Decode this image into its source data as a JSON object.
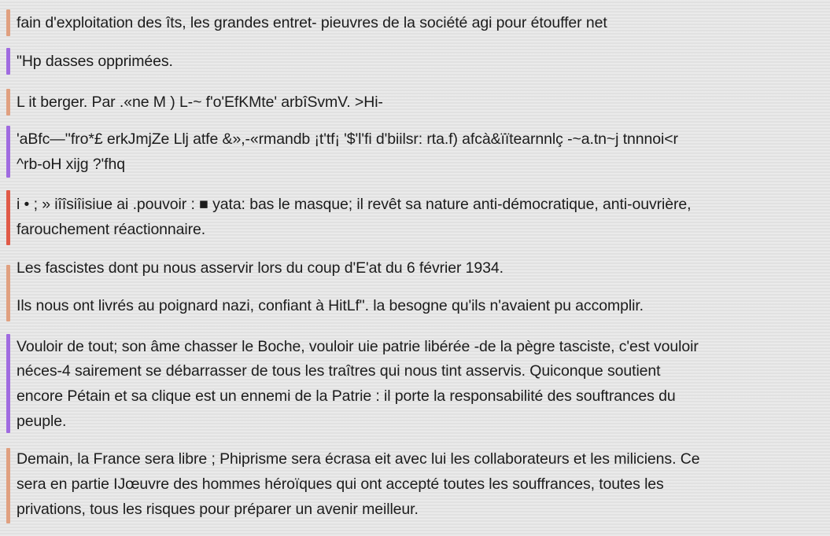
{
  "colors": {
    "background": "#e6e6e6",
    "text": "#1c1c1c",
    "bar_orange": "#e0a080",
    "bar_purple": "#a06be0",
    "bar_red": "#e05a48"
  },
  "paragraphs": [
    {
      "bar": "orange",
      "lines": [
        "fain d'exploitation des îts, les grandes entret- pieuvres de la société agi pour étouffer net"
      ]
    },
    {
      "bar": "purple",
      "lines": [
        "\"Hp dasses opprimées."
      ]
    },
    {
      "bar": "orange",
      "lines": [
        "L it berger. Par .«ne M ) L-~ f'o'EfKMte' arbîSvmV. >Hi-"
      ]
    },
    {
      "bar": "purple",
      "lines": [
        "'aBfc—''fro*£ erkJmjZe Llj atfe &»,-«rmandb ¡t'tf¡ '$'l'fi d'biilsr: rta.f) afcà&ïïtearnnlç -~a.tn~j tnnnoi<r",
        "^rb-oH xijg ?'fhq"
      ]
    },
    {
      "bar": "red",
      "lines": [
        "i • ; » iîîsiîisiue ai .pouvoir : ■ yata: bas le masque; il revêt sa nature anti-démocratique, anti-ouvrière,",
        "farouchement réactionnaire."
      ]
    },
    {
      "bar": "orange",
      "lines": [
        "Les fascistes dont pu nous asservir lors du coup d'E'at du 6 février 1934.",
        "Ils nous ont livrés au poignard nazi, confiant à HitLf\". la besogne qu'ils n'avaient pu accomplir."
      ]
    },
    {
      "bar": "purple",
      "lines": [
        "Vouloir de tout; son âme chasser le Boche, vouloir uie patrie libérée -de la pègre tasciste, c'est vouloir",
        "néces-4 sairement se débarrasser de tous les traîtres qui nous tint asservis. Quiconque soutient",
        "encore Pétain et sa clique est un ennemi de la Patrie : il porte la responsabilité des souftrances du",
        "peuple."
      ]
    },
    {
      "bar": "orange",
      "lines": [
        "Demain, la France sera libre ; Phiprisme sera écrasa eit avec lui les collaborateurs et les miliciens. Ce",
        "sera en partie IJœuvre des hommes héroïques qui ont accepté toutes les souffrances, toutes les",
        "privations, tous les risques pour préparer un avenir meilleur."
      ]
    }
  ]
}
